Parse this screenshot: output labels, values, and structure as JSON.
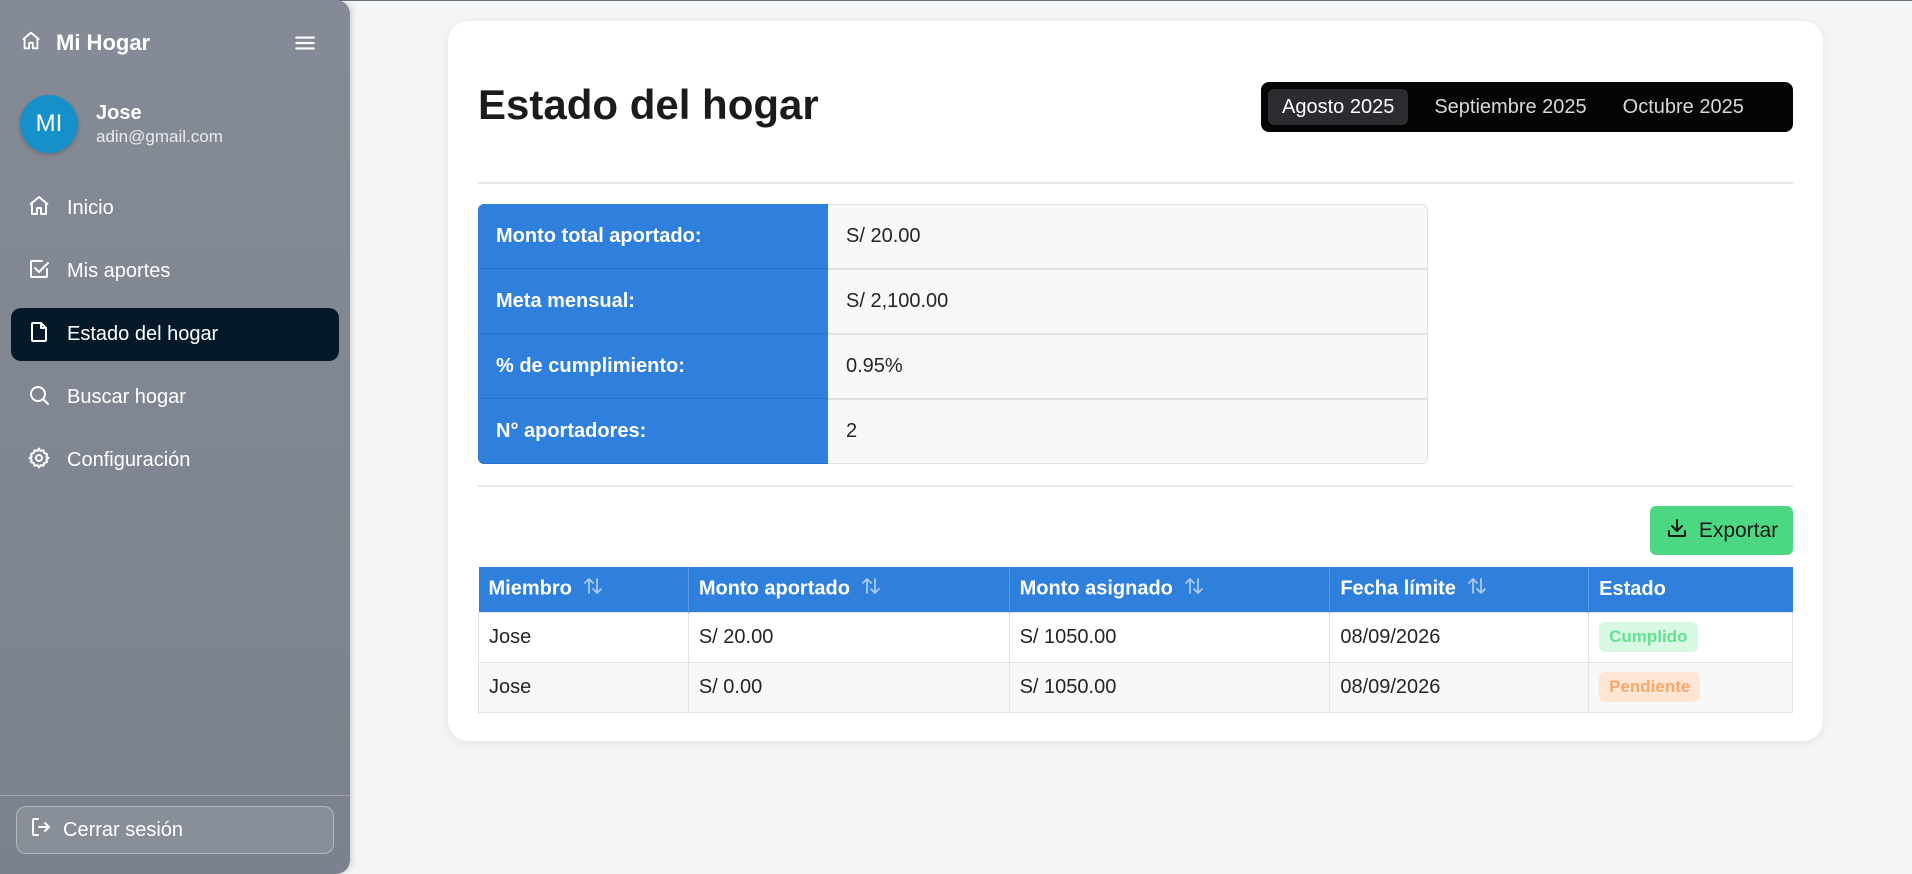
{
  "sidebar": {
    "brand": "Mi Hogar",
    "user": {
      "initials": "MI",
      "name": "Jose",
      "email": "adin@gmail.com"
    },
    "nav": [
      {
        "label": "Inicio",
        "icon": "home-icon"
      },
      {
        "label": "Mis aportes",
        "icon": "check-square-icon"
      },
      {
        "label": "Estado del hogar",
        "icon": "file-icon",
        "active": true
      },
      {
        "label": "Buscar hogar",
        "icon": "search-icon"
      },
      {
        "label": "Configuración",
        "icon": "gear-icon"
      }
    ],
    "logout": "Cerrar sesión"
  },
  "main": {
    "title": "Estado del hogar",
    "months": [
      "Agosto 2025",
      "Septiembre 2025",
      "Octubre 2025"
    ],
    "active_month": "Agosto 2025",
    "summary": [
      {
        "label": "Monto total aportado:",
        "value": "S/ 20.00"
      },
      {
        "label": "Meta mensual:",
        "value": "S/ 2,100.00"
      },
      {
        "label": "% de cumplimiento:",
        "value": "0.95%"
      },
      {
        "label": "N° aportadores:",
        "value": "2"
      }
    ],
    "export_label": "Exportar",
    "table": {
      "headers": [
        "Miembro",
        "Monto aportado",
        "Monto asignado",
        "Fecha límite",
        "Estado"
      ],
      "rows": [
        {
          "member": "Jose",
          "contributed": "S/ 20.00",
          "assigned": "S/ 1050.00",
          "deadline": "08/09/2026",
          "status": "Cumplido"
        },
        {
          "member": "Jose",
          "contributed": "S/ 0.00",
          "assigned": "S/ 1050.00",
          "deadline": "08/09/2026",
          "status": "Pendiente"
        }
      ]
    }
  },
  "colors": {
    "primary": "#2f7fdc",
    "active_nav": "#06192a",
    "export_button": "#4cd782",
    "status_done": "#64e092",
    "status_pending": "#f7a86b"
  }
}
